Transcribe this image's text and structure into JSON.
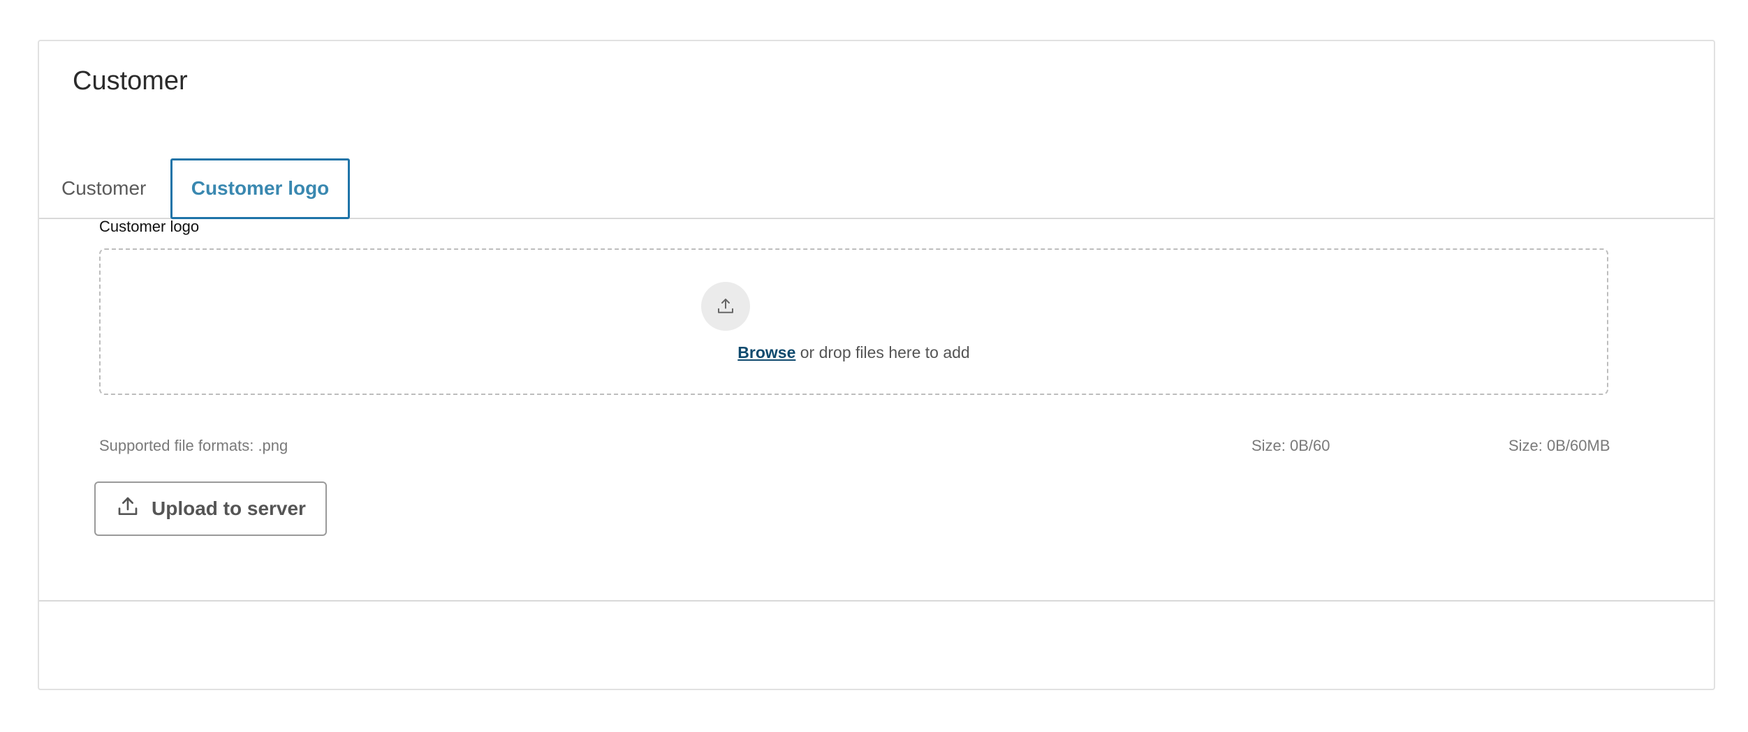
{
  "page": {
    "title": "Customer"
  },
  "tabs": [
    {
      "label": "Customer",
      "active": false
    },
    {
      "label": "Customer logo",
      "active": true
    }
  ],
  "field": {
    "label": "Customer logo"
  },
  "dropzone": {
    "icon": "upload-icon",
    "browse_label": "Browse",
    "drop_text": " or drop files here to add"
  },
  "meta": {
    "formats": "Supported file formats: .png",
    "size_count": "Size: 0B/60",
    "size_total": "Size: 0B/60MB"
  },
  "actions": {
    "upload_label": "Upload to server",
    "upload_icon": "upload-icon"
  },
  "colors": {
    "accent": "#1e74a8",
    "link": "#0f4a6e"
  }
}
